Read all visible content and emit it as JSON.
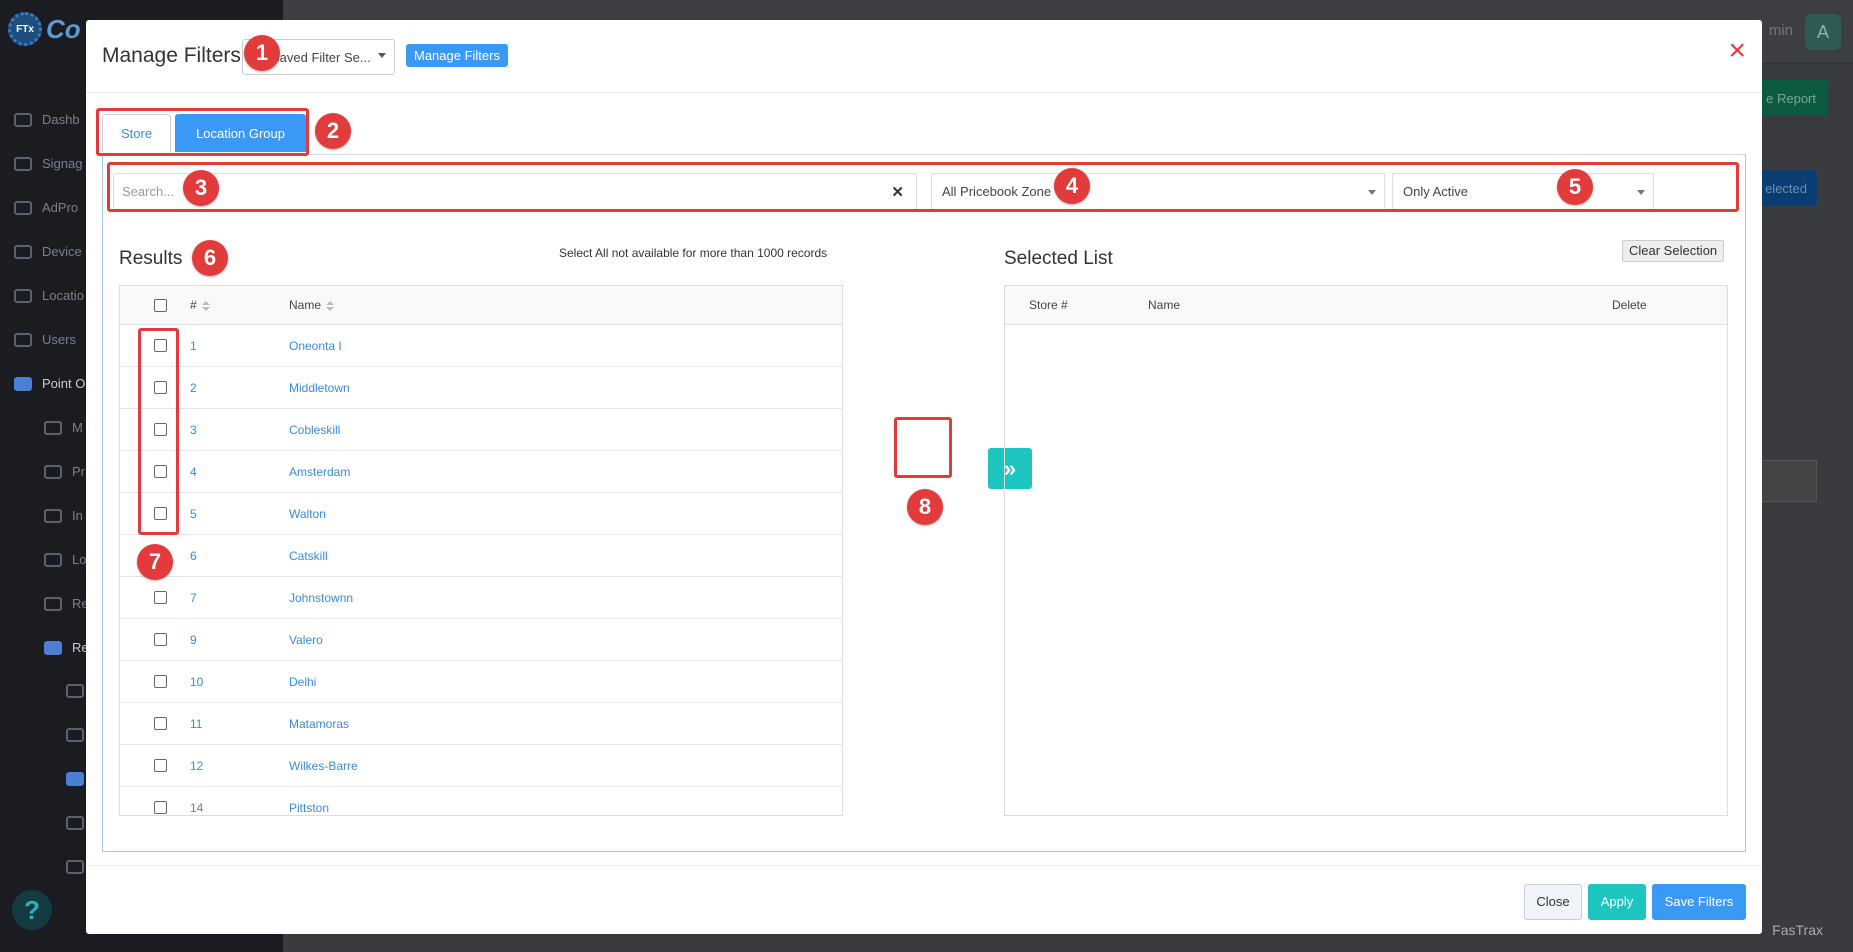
{
  "background": {
    "logo_badge": "FTx",
    "logo_text": "Co",
    "nav": [
      "Dashb",
      "Signag",
      "AdPro",
      "Device",
      "Locatio",
      "Users",
      "Point O"
    ],
    "subnav": [
      "M",
      "Pr",
      "In",
      "Lo",
      "Re",
      "Re"
    ],
    "admin_label": "min",
    "avatar": "A",
    "report_button": "e Report",
    "selected_button": "elected",
    "footer_text": "FasTrax",
    "help": "?"
  },
  "modal": {
    "title": "Manage Filters",
    "saved_filter_select": "Saved Filter Se...",
    "manage_filters_button": "Manage Filters",
    "close_icon": "×",
    "tabs": [
      {
        "label": "Store",
        "active": false
      },
      {
        "label": "Location Group",
        "active": true
      }
    ],
    "search": {
      "placeholder": "Search...",
      "value": "",
      "clear_icon": "✕"
    },
    "zone_select": {
      "value": "All Pricebook Zone"
    },
    "active_select": {
      "value": "Only Active"
    },
    "results": {
      "title": "Results",
      "note": "Select All not available for more than 1000 records",
      "columns": {
        "number": "#",
        "name": "Name"
      },
      "rows": [
        {
          "number": "1",
          "name": "Oneonta I"
        },
        {
          "number": "2",
          "name": "Middletown"
        },
        {
          "number": "3",
          "name": "Cobleskill"
        },
        {
          "number": "4",
          "name": "Amsterdam"
        },
        {
          "number": "5",
          "name": "Walton"
        },
        {
          "number": "6",
          "name": "Catskill"
        },
        {
          "number": "7",
          "name": "Johnstownn"
        },
        {
          "number": "9",
          "name": "Valero"
        },
        {
          "number": "10",
          "name": "Delhi"
        },
        {
          "number": "11",
          "name": "Matamoras"
        },
        {
          "number": "12",
          "name": "Wilkes-Barre"
        },
        {
          "number": "14",
          "name": "Pittston"
        }
      ]
    },
    "transfer_button": "»",
    "selected_list": {
      "title": "Selected List",
      "clear_button": "Clear Selection",
      "columns": {
        "store": "Store #",
        "name": "Name",
        "delete": "Delete"
      }
    },
    "footer": {
      "close": "Close",
      "apply": "Apply",
      "save": "Save Filters"
    }
  },
  "annotations": {
    "badges": [
      "1",
      "2",
      "3",
      "4",
      "5",
      "6",
      "7",
      "8"
    ],
    "color": "#e23b3b"
  }
}
